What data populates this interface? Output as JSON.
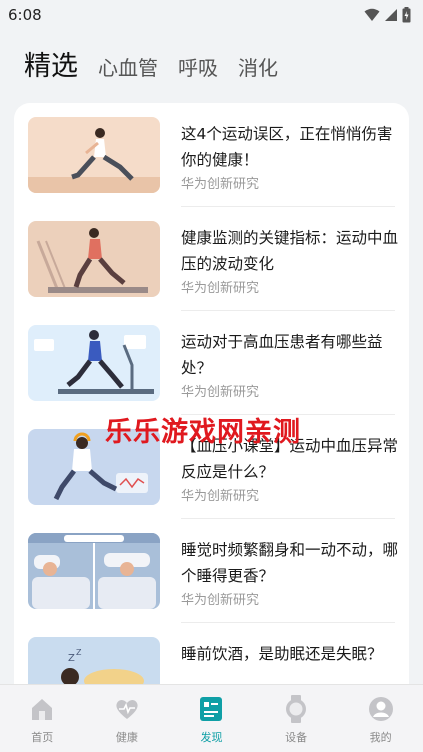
{
  "status": {
    "time": "6:08"
  },
  "tabs": [
    {
      "label": "精选",
      "active": true
    },
    {
      "label": "心血管",
      "active": false
    },
    {
      "label": "呼吸",
      "active": false
    },
    {
      "label": "消化",
      "active": false
    }
  ],
  "articles": [
    {
      "title": "这4个运动误区，正在悄悄伤害你的健康！",
      "source": "华为创新研究",
      "thumb": "lunge-exercise-illustration"
    },
    {
      "title": "健康监测的关键指标：运动中血压的波动变化",
      "source": "华为创新研究",
      "thumb": "treadmill-running-illustration"
    },
    {
      "title": "运动对于高血压患者有哪些益处？",
      "source": "华为创新研究",
      "thumb": "treadmill-monitor-illustration"
    },
    {
      "title": "【血压小课堂】运动中血压异常反应是什么？",
      "source": "华为创新研究",
      "thumb": "runner-headphones-illustration"
    },
    {
      "title": "睡觉时频繁翻身和一动不动，哪个睡得更香？",
      "source": "华为创新研究",
      "thumb": "sleeping-comparison-illustration"
    },
    {
      "title": "睡前饮酒，是助眠还是失眠？",
      "source": "",
      "thumb": "sleeping-person-illustration"
    }
  ],
  "watermark": "乐乐游戏网亲测",
  "bottom_nav": [
    {
      "label": "首页",
      "icon": "home-icon",
      "active": false
    },
    {
      "label": "健康",
      "icon": "heart-icon",
      "active": false
    },
    {
      "label": "发现",
      "icon": "discover-icon",
      "active": true
    },
    {
      "label": "设备",
      "icon": "watch-icon",
      "active": false
    },
    {
      "label": "我的",
      "icon": "profile-icon",
      "active": false
    }
  ],
  "colors": {
    "accent": "#0f9fa6",
    "background": "#f1f3f5",
    "watermark": "#e0191f"
  }
}
